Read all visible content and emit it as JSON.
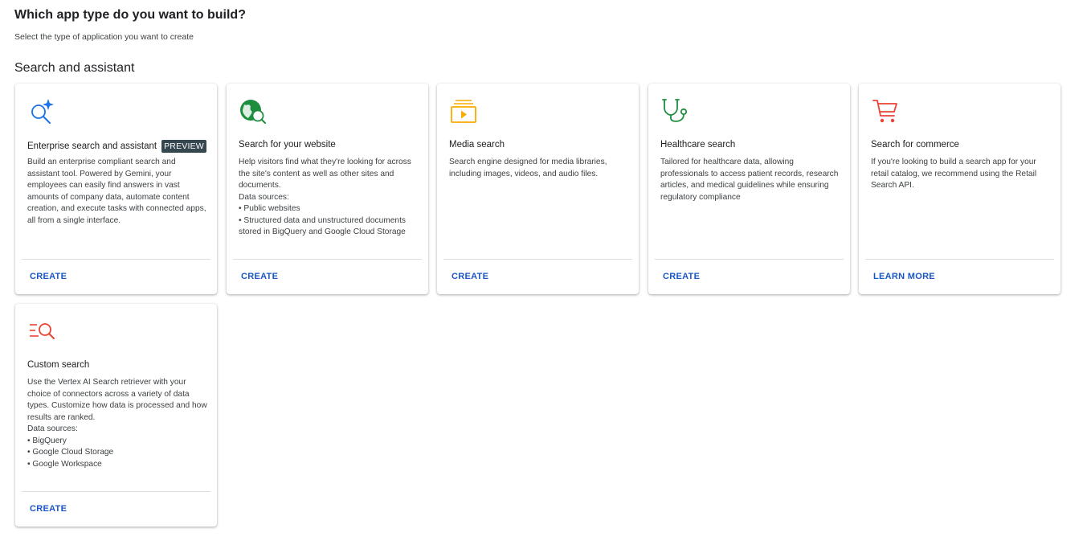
{
  "header": {
    "title": "Which app type do you want to build?",
    "subtitle": "Select the type of application you want to create"
  },
  "section": {
    "title": "Search and assistant"
  },
  "cards": [
    {
      "title": "Enterprise search and assistant",
      "badge": "PREVIEW",
      "description": "Build an enterprise compliant search and assistant tool. Powered by Gemini, your employees can easily find answers in vast amounts of company data, automate content creation, and execute tasks with connected apps, all from a single interface.",
      "action": "CREATE",
      "icon": "sparkle-search-icon"
    },
    {
      "title": "Search for your website",
      "description": "Help visitors find what they're looking for across the site's content as well as other sites and documents.",
      "data_sources_label": "Data sources:",
      "data_sources": [
        "• Public websites",
        "• Structured data and unstructured documents stored in BigQuery and Google Cloud Storage"
      ],
      "action": "CREATE",
      "icon": "globe-search-icon"
    },
    {
      "title": "Media search",
      "description": "Search engine designed for media libraries, including images, videos, and audio files.",
      "action": "CREATE",
      "icon": "media-library-icon"
    },
    {
      "title": "Healthcare search",
      "description": "Tailored for healthcare data, allowing professionals to access patient records, research articles, and medical guidelines while ensuring regulatory compliance",
      "action": "CREATE",
      "icon": "stethoscope-icon"
    },
    {
      "title": "Search for commerce",
      "description": "If you're looking to build a search app for your retail catalog, we recommend using the Retail Search API.",
      "action": "LEARN MORE",
      "icon": "shopping-cart-icon"
    },
    {
      "title": "Custom search",
      "description": "Use the Vertex AI Search retriever with your choice of connectors across a variety of data types. Customize how data is processed and how results are ranked.",
      "data_sources_label": "Data sources:",
      "data_sources": [
        "• BigQuery",
        "• Google Cloud Storage",
        "• Google Workspace"
      ],
      "action": "CREATE",
      "icon": "list-search-icon"
    }
  ],
  "colors": {
    "link": "#1a56c6",
    "blue": "#1a73e8",
    "green": "#1e8e3e",
    "yellow": "#f9ab00",
    "red": "#ea4335",
    "badge": "#37474f"
  }
}
